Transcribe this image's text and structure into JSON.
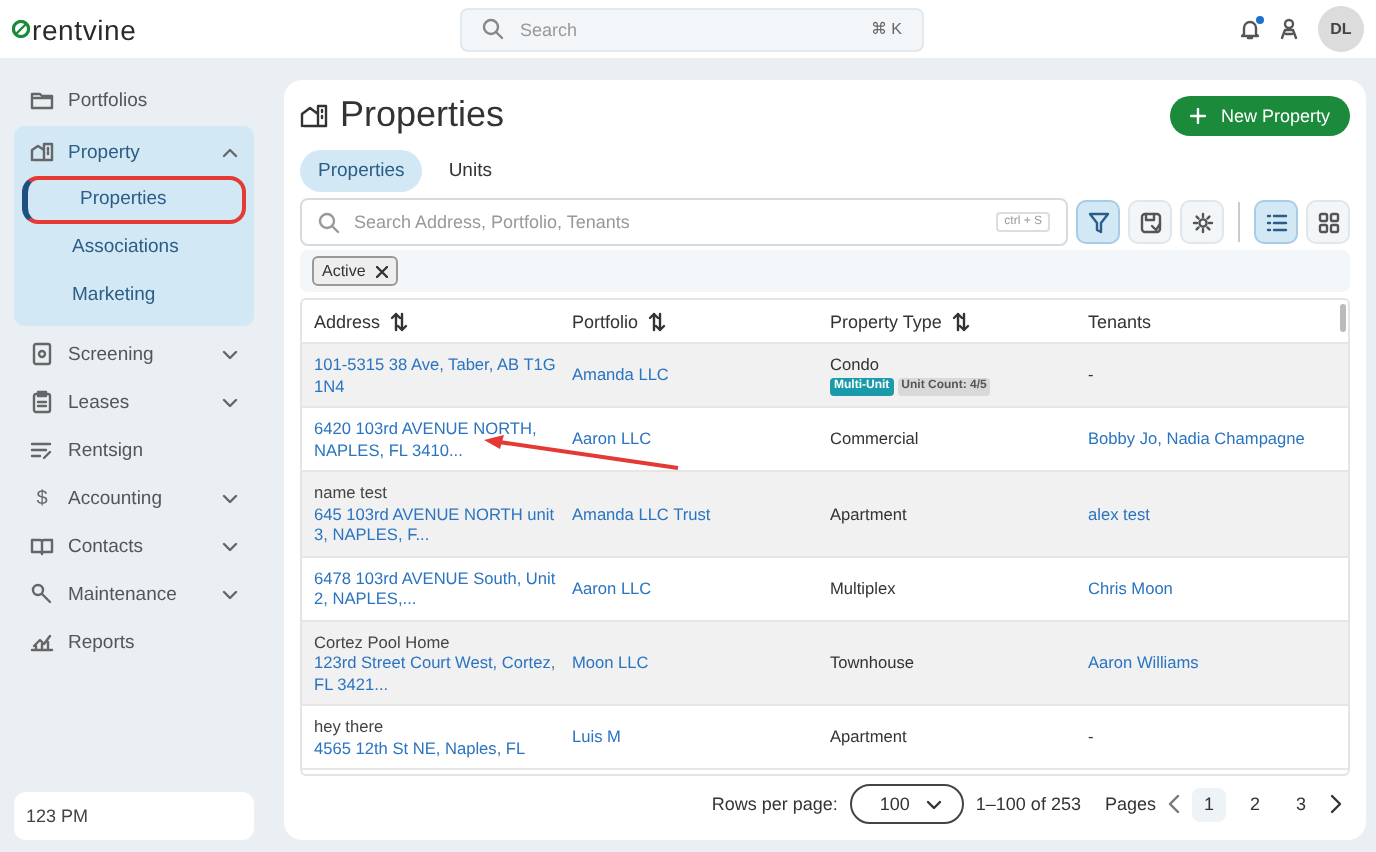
{
  "topbar": {
    "logo": "rentvine",
    "search": {
      "placeholder": "Search",
      "shortcut": "⌘ K"
    },
    "notification_dot": true,
    "avatar": "DL"
  },
  "sidebar": {
    "items": [
      {
        "label": "Portfolios",
        "expandable": false
      },
      {
        "label": "Property",
        "expandable": true,
        "expanded": true,
        "children": [
          {
            "label": "Properties",
            "selected": true,
            "circled": true
          },
          {
            "label": "Associations",
            "selected": false,
            "circled": false
          },
          {
            "label": "Marketing",
            "selected": false,
            "circled": false
          }
        ]
      },
      {
        "label": "Screening",
        "expandable": true,
        "expanded": false
      },
      {
        "label": "Leases",
        "expandable": true,
        "expanded": false
      },
      {
        "label": "Rentsign",
        "expandable": false
      },
      {
        "label": "Accounting",
        "expandable": true,
        "expanded": false,
        "glyph": "$"
      },
      {
        "label": "Contacts",
        "expandable": true,
        "expanded": false
      },
      {
        "label": "Maintenance",
        "expandable": true,
        "expanded": false
      },
      {
        "label": "Reports",
        "expandable": false
      }
    ],
    "footer": "123 PM"
  },
  "page": {
    "title": "Properties",
    "new_button": "New Property",
    "tabs": [
      {
        "label": "Properties",
        "selected": true
      },
      {
        "label": "Units",
        "selected": false
      }
    ],
    "search": {
      "placeholder": "Search Address, Portfolio, Tenants",
      "shortcut": "ctrl + S"
    },
    "toolbar": [
      {
        "kind": "filter",
        "selected": true
      },
      {
        "kind": "save",
        "selected": false
      },
      {
        "kind": "settings",
        "selected": false
      },
      {
        "kind": "list",
        "selected": true
      },
      {
        "kind": "grid",
        "selected": false
      }
    ],
    "filters": [
      {
        "label": "Active"
      }
    ],
    "table": {
      "columns": [
        {
          "label": "Address",
          "sortable": true
        },
        {
          "label": "Portfolio",
          "sortable": true
        },
        {
          "label": "Property Type",
          "sortable": true
        },
        {
          "label": "Tenants",
          "sortable": false
        }
      ],
      "rows": [
        {
          "address": "101-5315 38 Ave, Taber, AB T1G 1N4",
          "portfolio": "Amanda LLC",
          "type": "Condo",
          "badges": [
            {
              "label": "Multi-Unit",
              "color": "#1b9aaa"
            },
            {
              "label": "Unit Count: 4/5",
              "color": "#d9d9d9"
            }
          ],
          "tenants": "-",
          "tenants_linked": false,
          "arrow": false
        },
        {
          "address": "6420 103rd AVENUE NORTH, NAPLES, FL 3410...",
          "portfolio": "Aaron LLC",
          "type": "Commercial",
          "tenants": "Bobby Jo, Nadia Champagne",
          "tenants_linked": true,
          "arrow": true
        },
        {
          "name": "name test",
          "address": "645 103rd AVENUE NORTH unit 3, NAPLES, F...",
          "portfolio": "Amanda LLC Trust",
          "type": "Apartment",
          "tenants": "alex test",
          "tenants_linked": true,
          "arrow": false
        },
        {
          "address": "6478 103rd AVENUE South, Unit 2, NAPLES,...",
          "portfolio": "Aaron LLC",
          "type": "Multiplex",
          "tenants": "Chris Moon",
          "tenants_linked": true,
          "arrow": false
        },
        {
          "name": "Cortez Pool Home",
          "address": "123rd Street Court West, Cortez, FL 3421...",
          "portfolio": "Moon LLC",
          "type": "Townhouse",
          "tenants": "Aaron Williams",
          "tenants_linked": true,
          "arrow": false
        },
        {
          "name": "hey there",
          "address": "4565 12th St NE, Naples, FL",
          "portfolio": "Luis M",
          "type": "Apartment",
          "tenants": "-",
          "tenants_linked": false,
          "arrow": false
        }
      ]
    },
    "pagination": {
      "rows_label": "Rows per page:",
      "rows_per_page": "100",
      "range": "1–100 of 253",
      "pages_label": "Pages",
      "pages": [
        {
          "label": "1",
          "selected": true
        },
        {
          "label": "2",
          "selected": false
        },
        {
          "label": "3",
          "selected": false
        }
      ]
    }
  }
}
